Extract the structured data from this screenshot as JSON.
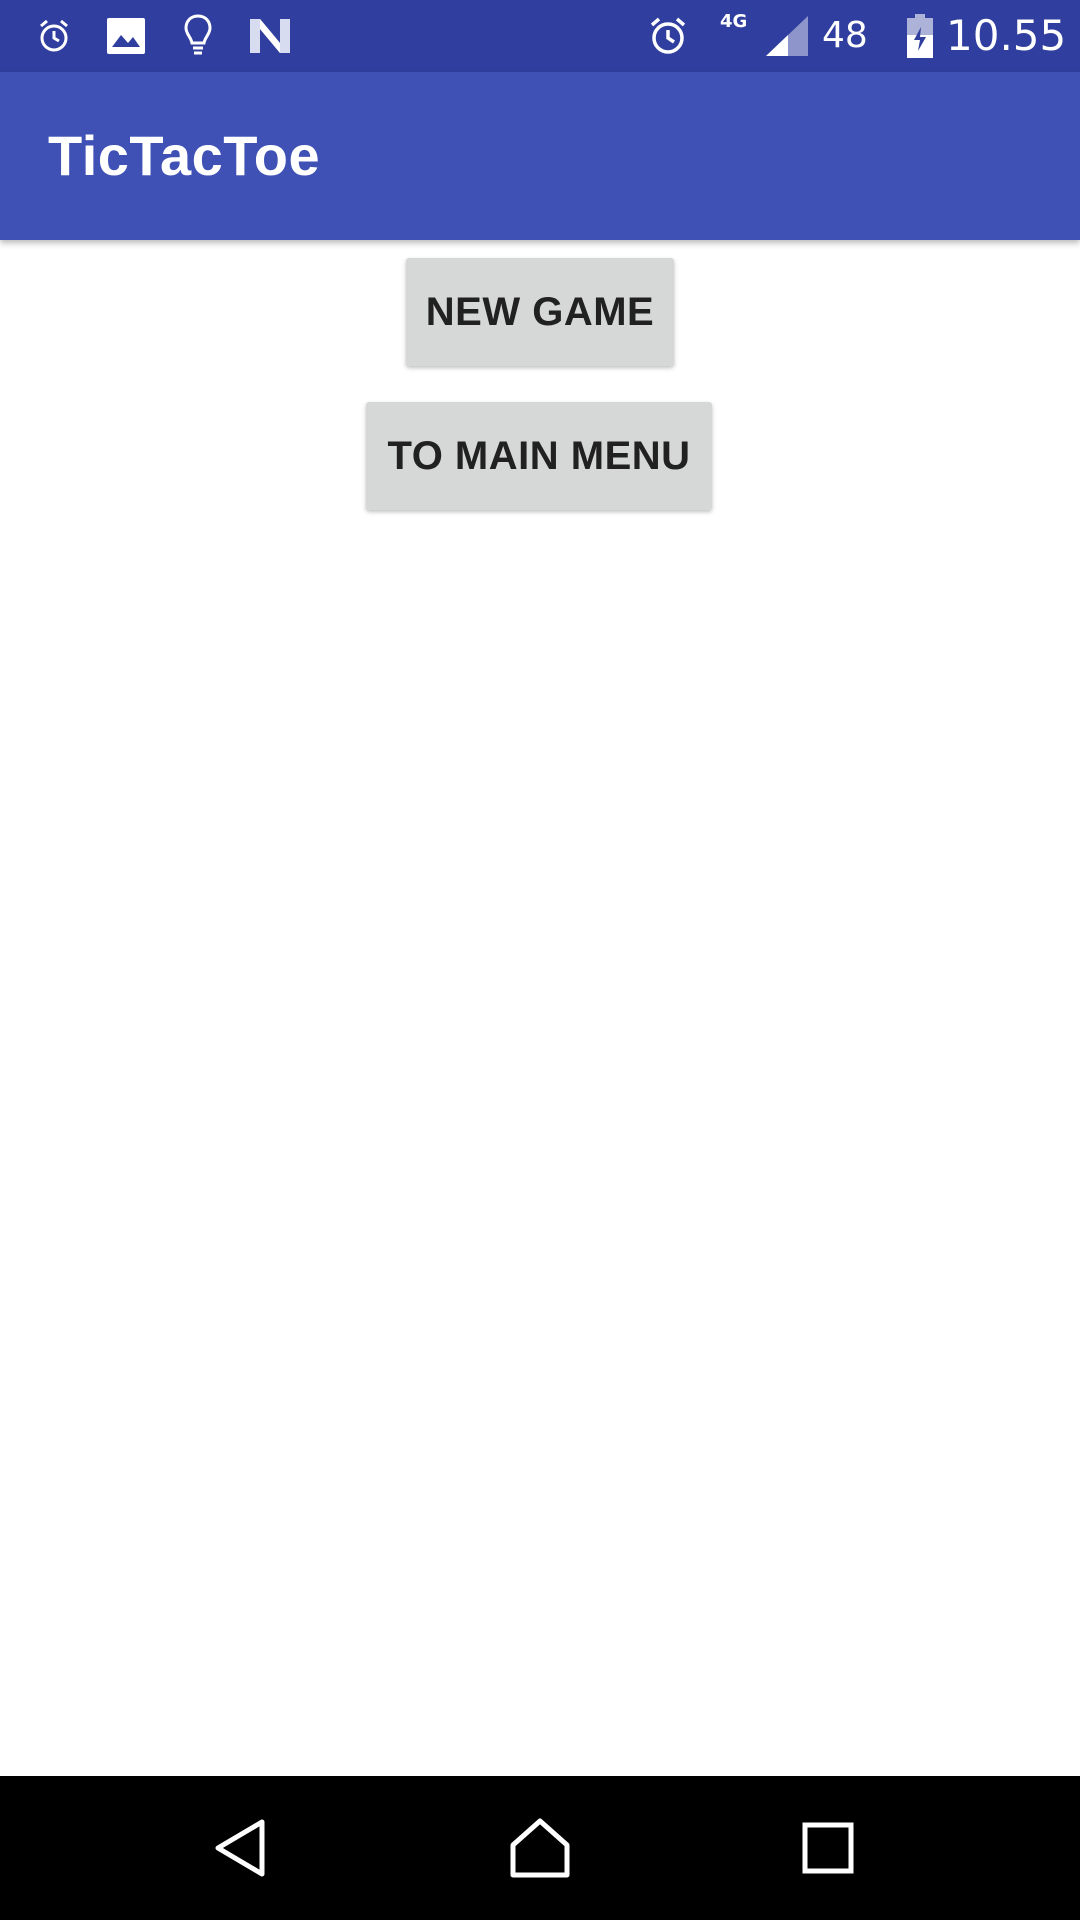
{
  "status_bar": {
    "icons_left": [
      "alarm-icon",
      "image-icon",
      "lightbulb-icon",
      "n-logo-icon"
    ],
    "network_label": "4G",
    "battery_text": "48 %",
    "time": "10.55"
  },
  "app_bar": {
    "title": "TicTacToe"
  },
  "buttons": {
    "new_game": "NEW GAME",
    "main_menu": "TO MAIN MENU"
  },
  "nav_bar": {
    "icons": [
      "back-icon",
      "home-icon",
      "recents-icon"
    ]
  },
  "colors": {
    "status_bar": "#303f9f",
    "app_bar": "#3f51b5",
    "button_bg": "#d6d7d7",
    "button_text": "#212121",
    "nav_bar": "#000000"
  }
}
